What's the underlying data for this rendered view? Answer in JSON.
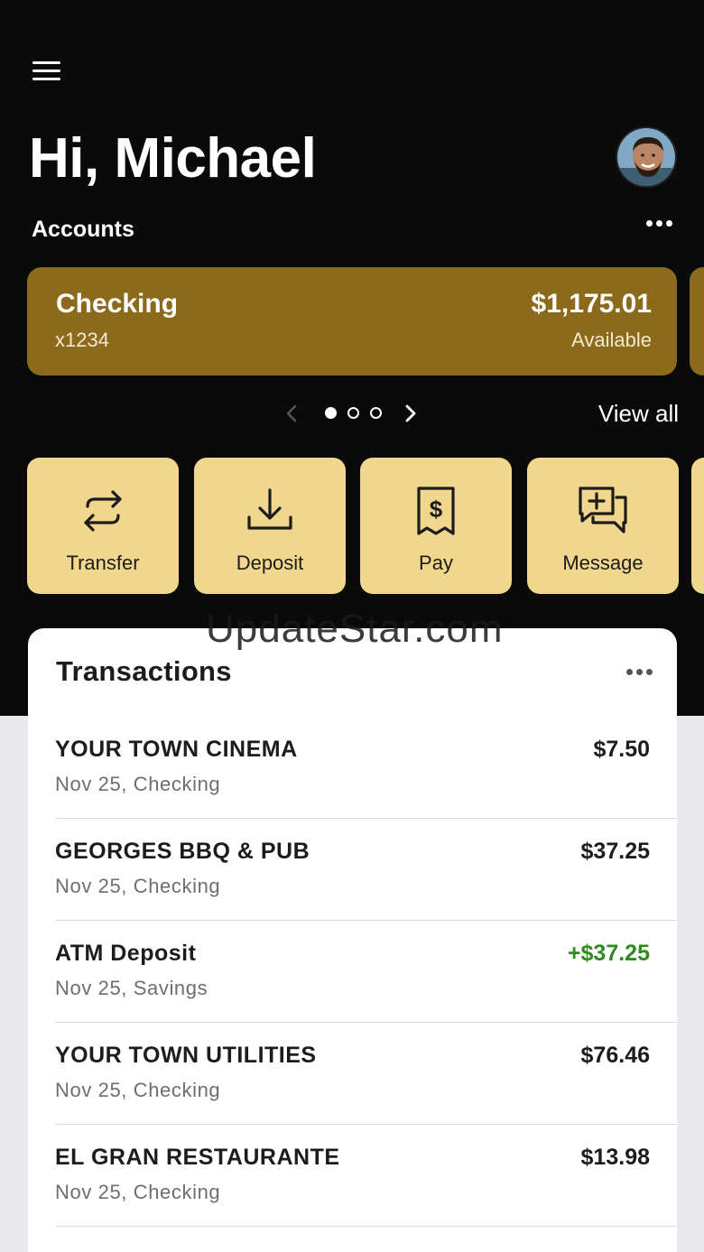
{
  "header": {
    "greeting": "Hi, Michael",
    "accounts_label": "Accounts"
  },
  "account_card": {
    "name": "Checking",
    "number": "x1234",
    "balance": "$1,175.01",
    "balance_label": "Available"
  },
  "carousel": {
    "pages": 3,
    "current": 1,
    "view_all": "View all"
  },
  "actions": [
    {
      "label": "Transfer",
      "icon": "transfer-icon"
    },
    {
      "label": "Deposit",
      "icon": "deposit-icon"
    },
    {
      "label": "Pay",
      "icon": "pay-bill-icon"
    },
    {
      "label": "Message",
      "icon": "message-icon"
    }
  ],
  "transactions": {
    "title": "Transactions",
    "items": [
      {
        "merchant": "YOUR TOWN CINEMA",
        "meta": "Nov 25, Checking",
        "amount": "$7.50"
      },
      {
        "merchant": "GEORGES BBQ & PUB",
        "meta": "Nov 25, Checking",
        "amount": "$37.25"
      },
      {
        "merchant": "ATM Deposit",
        "meta": "Nov 25, Savings",
        "amount": "+$37.25"
      },
      {
        "merchant": "YOUR TOWN UTILITIES",
        "meta": "Nov 25, Checking",
        "amount": "$76.46"
      },
      {
        "merchant": "EL GRAN RESTAURANTE",
        "meta": "Nov 25, Checking",
        "amount": "$13.98"
      }
    ]
  },
  "watermark": "UpdateStar.com",
  "colors": {
    "header_bg": "#0a0a0a",
    "account_card": "#8c6a1c",
    "action_button": "#f1d78d",
    "credit_amount": "#2f8a1f"
  }
}
